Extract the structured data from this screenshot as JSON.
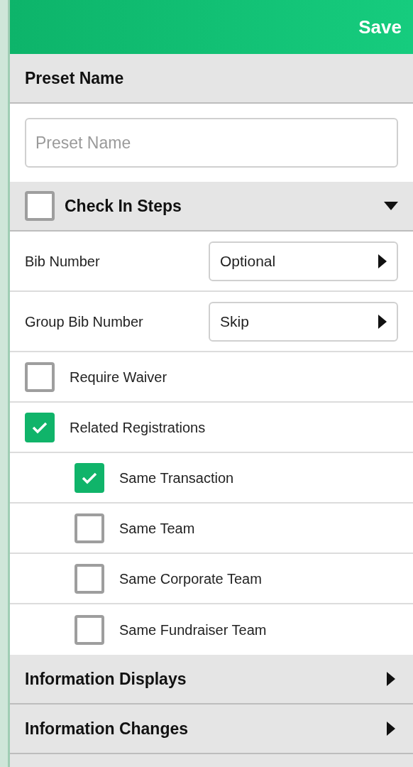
{
  "header": {
    "action": "Save"
  },
  "preset_section": {
    "title": "Preset Name",
    "field": {
      "placeholder": "Preset Name"
    }
  },
  "check_in_steps": {
    "title": "Check In Steps",
    "checked": false,
    "expanded": true,
    "selects": [
      {
        "label": "Bib Number",
        "value": "Optional"
      },
      {
        "label": "Group Bib Number",
        "value": "Skip"
      }
    ],
    "options": [
      {
        "label": "Require Waiver",
        "checked": false
      },
      {
        "label": "Related Registrations",
        "checked": true,
        "children": [
          {
            "label": "Same Transaction",
            "checked": true
          },
          {
            "label": "Same Team",
            "checked": false
          },
          {
            "label": "Same Corporate Team",
            "checked": false
          },
          {
            "label": "Same Fundraiser Team",
            "checked": false
          }
        ]
      }
    ]
  },
  "sections": [
    {
      "title": "Information Displays",
      "expanded": false
    },
    {
      "title": "Information Changes",
      "expanded": false
    }
  ]
}
